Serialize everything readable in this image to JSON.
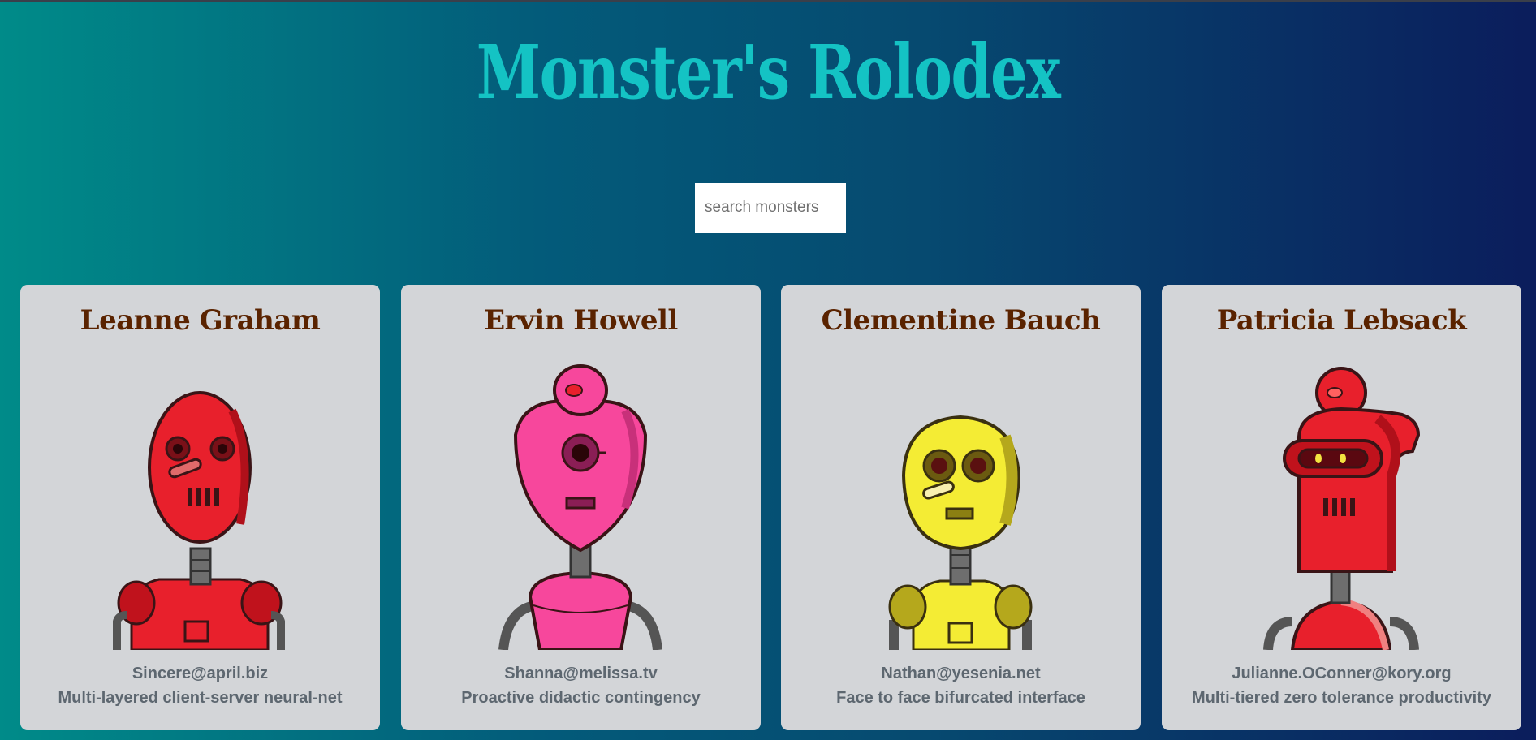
{
  "app": {
    "title": "Monster's Rolodex"
  },
  "search": {
    "placeholder": "search monsters",
    "value": ""
  },
  "monsters": [
    {
      "name": "Leanne Graham",
      "email": "Sincere@april.biz",
      "catch_phrase": "Multi-layered client-server neural-net",
      "color": "#e8202c",
      "image_icon": "red-robot-avatar"
    },
    {
      "name": "Ervin Howell",
      "email": "Shanna@melissa.tv",
      "catch_phrase": "Proactive didactic contingency",
      "color": "#f7479c",
      "image_icon": "pink-robot-avatar"
    },
    {
      "name": "Clementine Bauch",
      "email": "Nathan@yesenia.net",
      "catch_phrase": "Face to face bifurcated interface",
      "color": "#f4ec34",
      "image_icon": "yellow-robot-avatar"
    },
    {
      "name": "Patricia Lebsack",
      "email": "Julianne.OConner@kory.org",
      "catch_phrase": "Multi-tiered zero tolerance productivity",
      "color": "#e8202c",
      "image_icon": "red-hooded-robot-avatar"
    }
  ],
  "colors": {
    "title": "#14c3c4",
    "card_background": "#d3d5d8",
    "name_text": "#5a2300",
    "detail_text": "#5d6770"
  }
}
